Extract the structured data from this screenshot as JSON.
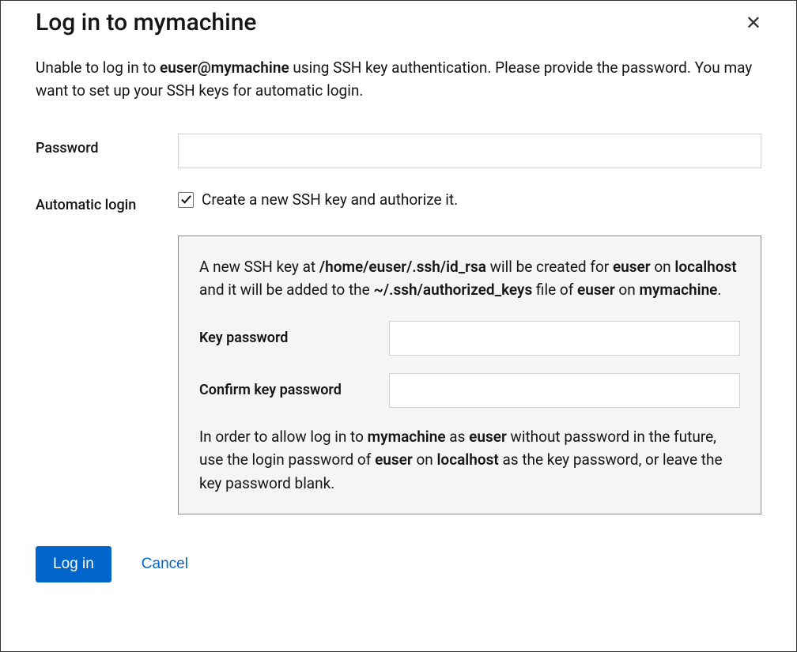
{
  "dialog": {
    "title": "Log in to mymachine",
    "description_parts": {
      "pre": "Unable to log in to ",
      "user_host": "euser@mymachine",
      "post": " using SSH key authentication. Please provide the password. You may want to set up your SSH keys for automatic login."
    }
  },
  "form": {
    "password_label": "Password",
    "auto_login_label": "Automatic login",
    "checkbox_label": "Create a new SSH key and authorize it.",
    "checkbox_checked": true
  },
  "panel": {
    "line1": {
      "t1": "A new SSH key at ",
      "path": "/home/euser/.ssh/id_rsa",
      "t2": " will be created for ",
      "user1": "euser",
      "t3": " on ",
      "host1": "localhost",
      "t4": " and it will be added to the ",
      "authfile": "~/.ssh/authorized_keys",
      "t5": " file of ",
      "user2": "euser",
      "t6": " on ",
      "host2": "mymachine",
      "t7": "."
    },
    "key_password_label": "Key password",
    "confirm_key_password_label": "Confirm key password",
    "line2": {
      "t1": "In order to allow log in to ",
      "host": "mymachine",
      "t2": " as ",
      "user1": "euser",
      "t3": " without password in the future, use the login password of ",
      "user2": "euser",
      "t4": " on ",
      "localhost": "localhost",
      "t5": " as the key password, or leave the key password blank."
    }
  },
  "buttons": {
    "login": "Log in",
    "cancel": "Cancel"
  }
}
